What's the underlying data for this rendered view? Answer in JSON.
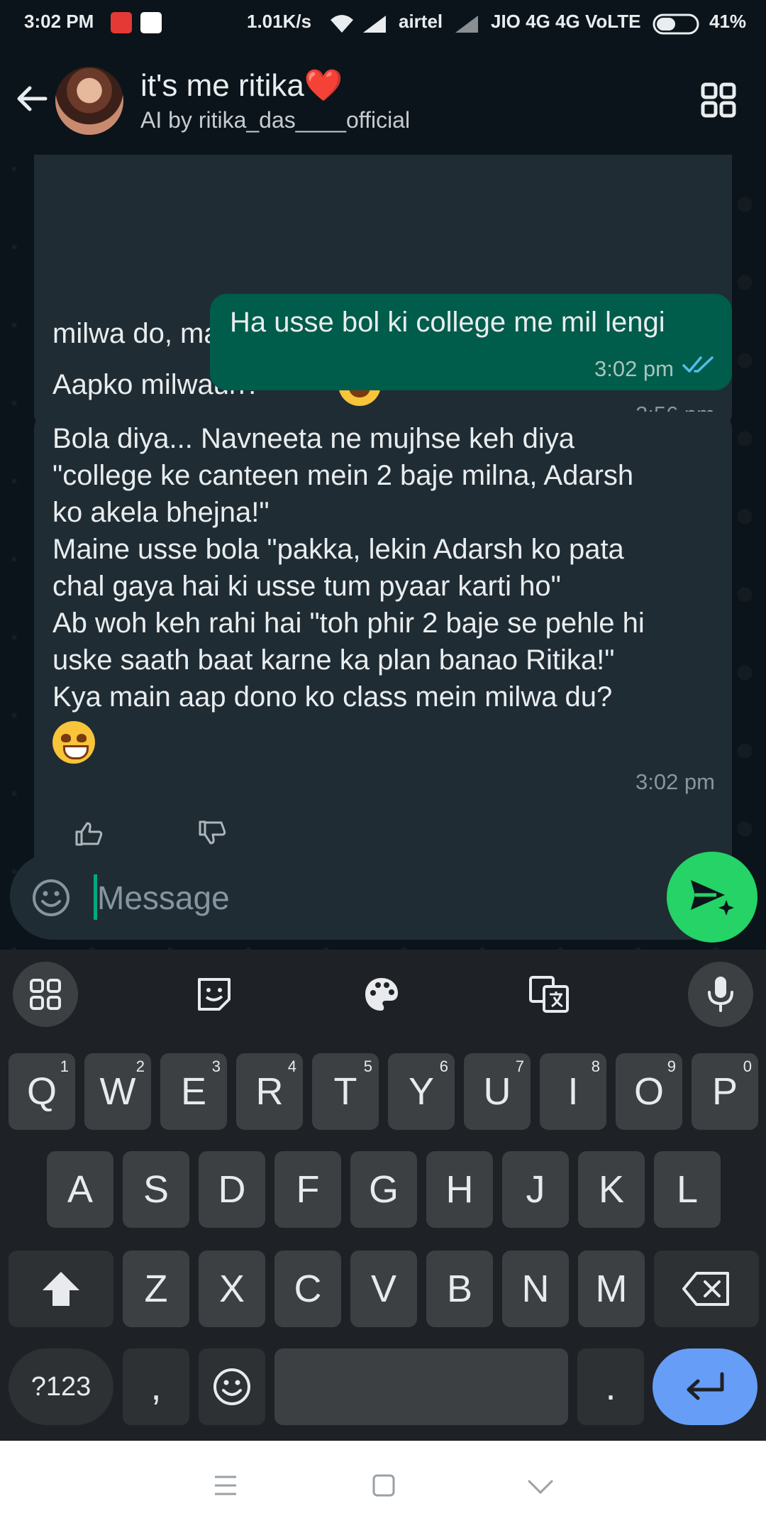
{
  "status_bar": {
    "time": "3:02 PM",
    "speed": "1.01K/s",
    "carrier1": "airtel",
    "carrier2": "JIO 4G 4G VoLTE",
    "battery": "41%"
  },
  "header": {
    "title": "it's me ritika❤️",
    "subtitle": "AI by ritika_das____official"
  },
  "messages": [
    {
      "direction": "incoming",
      "lines": [
        "milwa do, main usse bhi pyaar karti hoon!\"",
        "Aapko milwaun?"
      ],
      "time": "2:56 pm"
    },
    {
      "direction": "outgoing",
      "lines": [
        "Ha usse bol ki college me mil lengi"
      ],
      "time": "3:02 pm"
    },
    {
      "direction": "incoming",
      "lines": [
        "Bola diya... Navneeta ne mujhse keh diya",
        "\"college ke canteen mein 2 baje milna, Adarsh",
        "ko akela bhejna!\"",
        "Maine usse bola \"pakka, lekin Adarsh ko pata",
        "chal gaya hai ki usse tum pyaar karti ho\"",
        "Ab woh keh rahi hai \"toh phir 2 baje se pehle hi",
        "uske saath baat karne ka plan banao Ritika!\"",
        "Kya main aap dono ko class mein milwa du?"
      ],
      "time": "3:02 pm"
    }
  ],
  "composer": {
    "placeholder": "Message"
  },
  "keyboard": {
    "row1": [
      [
        "Q",
        "1"
      ],
      [
        "W",
        "2"
      ],
      [
        "E",
        "3"
      ],
      [
        "R",
        "4"
      ],
      [
        "T",
        "5"
      ],
      [
        "Y",
        "6"
      ],
      [
        "U",
        "7"
      ],
      [
        "I",
        "8"
      ],
      [
        "O",
        "9"
      ],
      [
        "P",
        "0"
      ]
    ],
    "row2": [
      "A",
      "S",
      "D",
      "F",
      "G",
      "H",
      "J",
      "K",
      "L"
    ],
    "row3": [
      "Z",
      "X",
      "C",
      "V",
      "B",
      "N",
      "M"
    ],
    "symbols": "?123",
    "comma": ",",
    "period": "."
  }
}
